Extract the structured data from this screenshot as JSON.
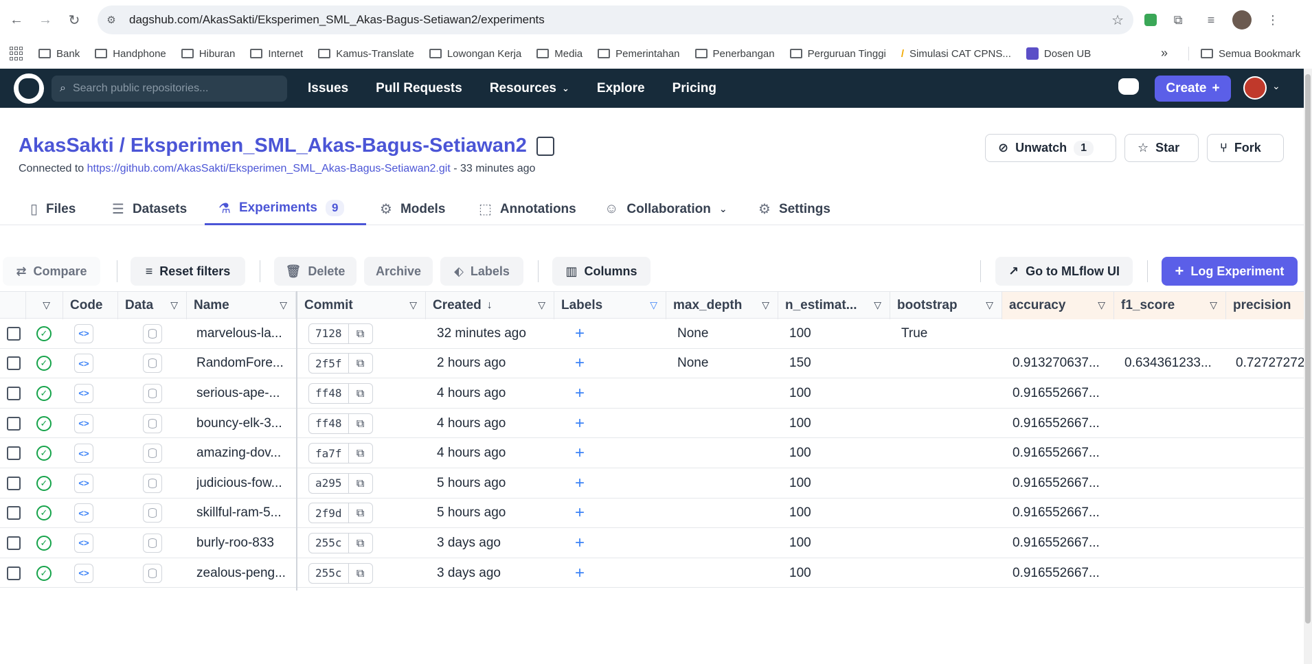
{
  "browser": {
    "url": "dagshub.com/AkasSakti/Eksperimen_SML_Akas-Bagus-Setiawan2/experiments",
    "bookmarks": [
      "Bank",
      "Handphone",
      "Hiburan",
      "Internet",
      "Kamus-Translate",
      "Lowongan Kerja",
      "Media",
      "Pemerintahan",
      "Penerbangan",
      "Perguruan Tinggi",
      "Simulasi CAT CPNS...",
      "Dosen UB"
    ],
    "bookmarks_more": "»",
    "bookmarks_all": "Semua Bookmark"
  },
  "header": {
    "search_placeholder": "Search public repositories...",
    "nav": [
      "Issues",
      "Pull Requests",
      "Resources",
      "Explore",
      "Pricing"
    ],
    "create_label": "Create"
  },
  "repo": {
    "owner": "AkasSakti",
    "separator": " / ",
    "name": "Eksperimen_SML_Akas-Bagus-Setiawan2",
    "connected_prefix": "Connected to ",
    "connected_url": "https://github.com/AkasSakti/Eksperimen_SML_Akas-Bagus-Setiawan2.git",
    "connected_suffix": " - 33 minutes ago",
    "unwatch_label": "Unwatch",
    "unwatch_count": "1",
    "star_label": "Star",
    "fork_label": "Fork"
  },
  "tabs": {
    "files": "Files",
    "datasets": "Datasets",
    "experiments": "Experiments",
    "experiments_count": "9",
    "models": "Models",
    "annotations": "Annotations",
    "collaboration": "Collaboration",
    "settings": "Settings"
  },
  "toolbar": {
    "compare": "Compare",
    "reset_filters": "Reset filters",
    "delete": "Delete",
    "archive": "Archive",
    "labels": "Labels",
    "columns": "Columns",
    "mlflow": "Go to MLflow UI",
    "log_experiment": "Log Experiment"
  },
  "table": {
    "headers": {
      "code": "Code",
      "data": "Data",
      "name": "Name",
      "commit": "Commit",
      "created": "Created",
      "created_sort": "↓",
      "labels": "Labels",
      "max_depth": "max_depth",
      "n_estimators": "n_estimat...",
      "bootstrap": "bootstrap",
      "accuracy": "accuracy",
      "f1_score": "f1_score",
      "precision": "precision"
    },
    "rows": [
      {
        "name": "marvelous-la...",
        "commit": "7128",
        "created": "32 minutes ago",
        "label_add": "+",
        "max_depth": "None",
        "n_estimators": "100",
        "bootstrap": "True",
        "accuracy": "",
        "f1_score": "",
        "precision": ""
      },
      {
        "name": "RandomFore...",
        "commit": "2f5f",
        "created": "2 hours ago",
        "label_add": "+",
        "max_depth": "None",
        "n_estimators": "150",
        "bootstrap": "",
        "accuracy": "0.913270637...",
        "f1_score": "0.634361233...",
        "precision": "0.72727272"
      },
      {
        "name": "serious-ape-...",
        "commit": "ff48",
        "created": "4 hours ago",
        "label_add": "+",
        "max_depth": "",
        "n_estimators": "100",
        "bootstrap": "",
        "accuracy": "0.916552667...",
        "f1_score": "",
        "precision": ""
      },
      {
        "name": "bouncy-elk-3...",
        "commit": "ff48",
        "created": "4 hours ago",
        "label_add": "+",
        "max_depth": "",
        "n_estimators": "100",
        "bootstrap": "",
        "accuracy": "0.916552667...",
        "f1_score": "",
        "precision": ""
      },
      {
        "name": "amazing-dov...",
        "commit": "fa7f",
        "created": "4 hours ago",
        "label_add": "+",
        "max_depth": "",
        "n_estimators": "100",
        "bootstrap": "",
        "accuracy": "0.916552667...",
        "f1_score": "",
        "precision": ""
      },
      {
        "name": "judicious-fow...",
        "commit": "a295",
        "created": "5 hours ago",
        "label_add": "+",
        "max_depth": "",
        "n_estimators": "100",
        "bootstrap": "",
        "accuracy": "0.916552667...",
        "f1_score": "",
        "precision": ""
      },
      {
        "name": "skillful-ram-5...",
        "commit": "2f9d",
        "created": "5 hours ago",
        "label_add": "+",
        "max_depth": "",
        "n_estimators": "100",
        "bootstrap": "",
        "accuracy": "0.916552667...",
        "f1_score": "",
        "precision": ""
      },
      {
        "name": "burly-roo-833",
        "commit": "255c",
        "created": "3 days ago",
        "label_add": "+",
        "max_depth": "",
        "n_estimators": "100",
        "bootstrap": "",
        "accuracy": "0.916552667...",
        "f1_score": "",
        "precision": ""
      },
      {
        "name": "zealous-peng...",
        "commit": "255c",
        "created": "3 days ago",
        "label_add": "+",
        "max_depth": "",
        "n_estimators": "100",
        "bootstrap": "",
        "accuracy": "0.916552667...",
        "f1_score": "",
        "precision": ""
      }
    ]
  }
}
